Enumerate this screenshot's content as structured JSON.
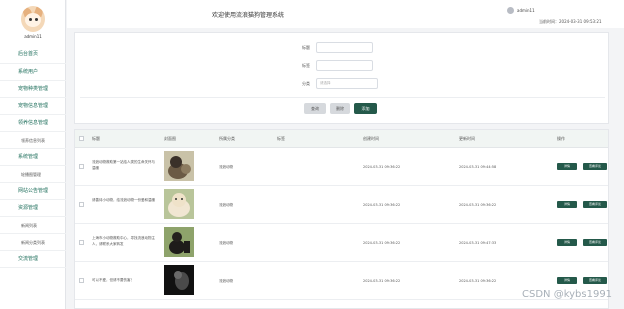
{
  "header": {
    "system_title": "欢迎使用流浪猫狗管理系统",
    "user_name": "admin11",
    "time_label": "当前时间：",
    "time_value": "2024-03-31 09:53:21"
  },
  "sidebar": {
    "user": "admin11",
    "items": [
      {
        "label": "后台首页",
        "sub": false
      },
      {
        "label": "系统用户",
        "sub": false
      },
      {
        "label": "宠物种类管理",
        "sub": false
      },
      {
        "label": "宠物信息管理",
        "sub": false
      },
      {
        "label": "领养信息管理",
        "sub": false
      },
      {
        "label": "领养信息列表",
        "sub": true
      },
      {
        "label": "系统管理",
        "sub": false
      },
      {
        "label": "轮播图管理",
        "sub": true
      },
      {
        "label": "网站公告管理",
        "sub": false
      },
      {
        "label": "资源管理",
        "sub": false
      },
      {
        "label": "新闻列表",
        "sub": true
      },
      {
        "label": "新闻分类列表",
        "sub": true
      },
      {
        "label": "交流管理",
        "sub": false
      }
    ]
  },
  "search": {
    "title_label": "标题",
    "tag_label": "标签",
    "category_label": "分类",
    "category_placeholder": "请选择",
    "reset_label": "查询",
    "delete_label": "删除",
    "add_label": "添加"
  },
  "table": {
    "headers": [
      "标题",
      "封面图",
      "所属分类",
      "标签",
      "创建时间",
      "更新时间",
      "操作"
    ],
    "rows": [
      {
        "title": "流浪动物救助第一站给人类的生命关怀与温暖",
        "category": "流浪动物",
        "tag": "",
        "created": "2024-03-31 09:36:22",
        "updated": "2024-03-31 09:44:58",
        "thumb": "dog1"
      },
      {
        "title": "请善待小动物，给流浪动物一份爱和温暖",
        "category": "流浪动物",
        "tag": "",
        "created": "2024-03-31 09:36:22",
        "updated": "2024-03-31 09:36:22",
        "thumb": "dog2"
      },
      {
        "title": "上海市小动物救助中心，寻找流浪动物主人，请联系大家转发",
        "category": "流浪动物",
        "tag": "",
        "created": "2024-03-31 09:36:22",
        "updated": "2024-03-31 09:47:33",
        "thumb": "dog3"
      },
      {
        "title": "可以不爱，但请不要伤害！",
        "category": "流浪动物",
        "tag": "",
        "created": "2024-03-31 09:36:22",
        "updated": "2024-03-31 09:36:22",
        "thumb": "dog4"
      }
    ],
    "detail_label": "详情",
    "comment_label": "查看评论"
  },
  "watermark": "CSDN @kybs1991",
  "colors": {
    "accent": "#24594a",
    "menu_text": "#1f6f5c"
  }
}
